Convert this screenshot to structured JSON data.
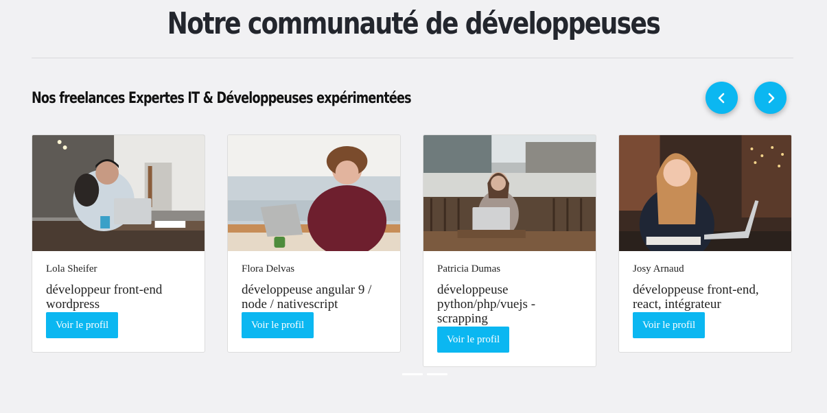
{
  "page": {
    "title": "Notre communauté de développeuses",
    "section_title": "Nos freelances Expertes IT & Développeuses expérimentées"
  },
  "carousel": {
    "prev_icon": "chevron-left-icon",
    "next_icon": "chevron-right-icon",
    "accent_color": "#0bb7f1",
    "cards": [
      {
        "name": "Lola Sheifer",
        "role": "développeur front-end wordpress",
        "button": "Voir le profil"
      },
      {
        "name": "Flora Delvas",
        "role": "développeuse angular 9 / node / nativescript",
        "button": "Voir le profil"
      },
      {
        "name": "Patricia Dumas",
        "role": "développeuse python/php/vuejs - scrapping",
        "button": "Voir le profil"
      },
      {
        "name": "Josy Arnaud",
        "role": "développeuse front-end, react, intégrateur",
        "button": "Voir le profil"
      }
    ],
    "page_count": 2
  }
}
